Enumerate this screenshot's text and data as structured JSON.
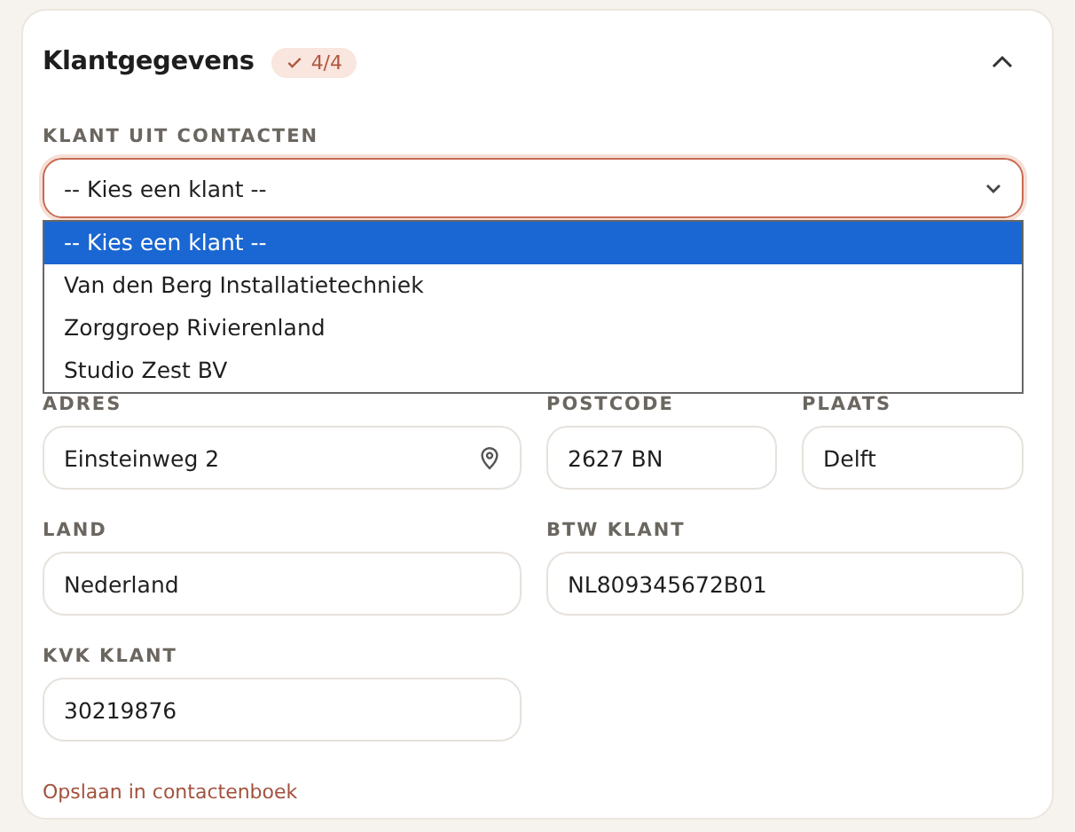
{
  "section": {
    "title": "Klantgegevens",
    "badge": "4/4",
    "expanded": true
  },
  "contact_select": {
    "label": "KLANT UIT CONTACTEN",
    "value": "-- Kies een klant --",
    "open": true,
    "options": [
      {
        "label": "-- Kies een klant --",
        "selected": true
      },
      {
        "label": "Van den Berg Installatietechniek",
        "selected": false
      },
      {
        "label": "Zorggroep Rivierenland",
        "selected": false
      },
      {
        "label": "Studio Zest BV",
        "selected": false
      }
    ]
  },
  "rows": [
    [
      {
        "label": "ADRES",
        "value": "Einsteinweg 2",
        "kind": "address"
      },
      {
        "label": "POSTCODE",
        "value": "2627 BN",
        "kind": "text"
      },
      {
        "label": "PLAATS",
        "value": "Delft",
        "kind": "text"
      }
    ],
    [
      {
        "label": "LAND",
        "value": "Nederland",
        "kind": "text"
      },
      {
        "label": "BTW KLANT",
        "value": "NL809345672B01",
        "kind": "text"
      }
    ],
    [
      {
        "label": "KVK KLANT",
        "value": "30219876",
        "kind": "text"
      }
    ]
  ],
  "link": "Opslaan in contactenboek"
}
